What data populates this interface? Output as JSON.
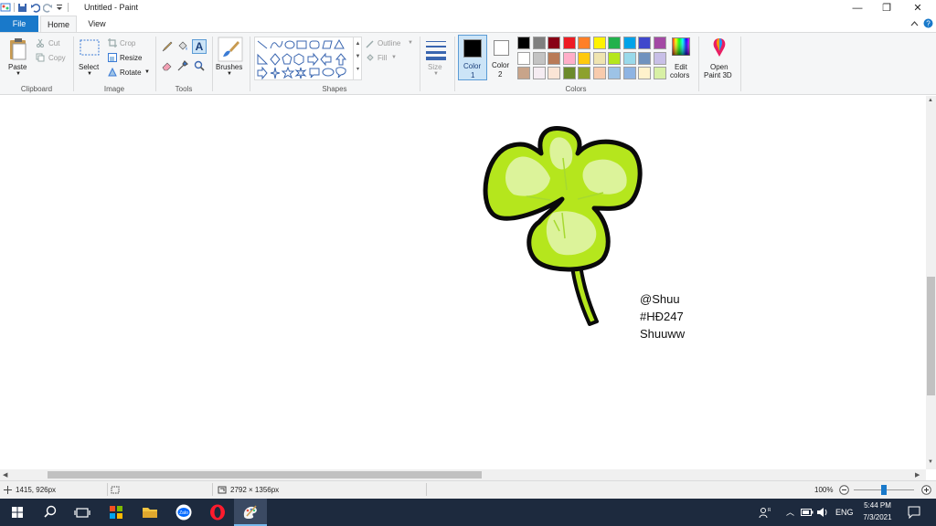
{
  "window": {
    "title": "Untitled - Paint",
    "minimize": "—",
    "restore": "❐",
    "close": "✕"
  },
  "tabs": {
    "file": "File",
    "home": "Home",
    "view": "View"
  },
  "ribbon": {
    "clipboard": {
      "label": "Clipboard",
      "paste": "Paste",
      "cut": "Cut",
      "copy": "Copy"
    },
    "image": {
      "label": "Image",
      "select": "Select",
      "crop": "Crop",
      "resize": "Resize",
      "rotate": "Rotate"
    },
    "tools": {
      "label": "Tools"
    },
    "brushes": "Brushes",
    "shapes": {
      "label": "Shapes",
      "outline": "Outline",
      "fill": "Fill"
    },
    "size": "Size",
    "color1": [
      "Color",
      "1"
    ],
    "color2": [
      "Color",
      "2"
    ],
    "colors": {
      "label": "Colors",
      "edit": [
        "Edit",
        "colors"
      ],
      "swatches": [
        "#000000",
        "#7f7f7f",
        "#880015",
        "#ed1c24",
        "#ff7f27",
        "#fff200",
        "#22b14c",
        "#00a2e8",
        "#3f48cc",
        "#a349a4",
        "#ffffff",
        "#c3c3c3",
        "#b97a57",
        "#ffaec9",
        "#ffc90e",
        "#efe4b0",
        "#b5e61d",
        "#99d9ea",
        "#7092be",
        "#c8bfe7",
        "#c8a48a",
        "#f5ecf2",
        "#fbe5d6",
        "#6c8a2c",
        "#8da12e",
        "#f8cbad",
        "#9dc3e6",
        "#8eb4e3",
        "#fff2cc",
        "#d8f0a5"
      ]
    },
    "paint3d": [
      "Open",
      "Paint 3D"
    ]
  },
  "canvas": {
    "signature": [
      "@Shuu",
      "#HĐ247",
      "Shuuww"
    ],
    "clover_colors": {
      "outline": "#0a0a0a",
      "leaf": "#b5e61d",
      "leaf_light": "#dcf39a",
      "vein": "#a6d930"
    }
  },
  "status": {
    "cursor_pos": "1415, 926px",
    "canvas_size": "2792 × 1356px",
    "zoom": "100%",
    "zoom_level": 0.5
  },
  "taskbar": {
    "language": "ENG",
    "time": "5:44 PM",
    "date": "7/3/2021"
  },
  "accent": "#1979ca"
}
